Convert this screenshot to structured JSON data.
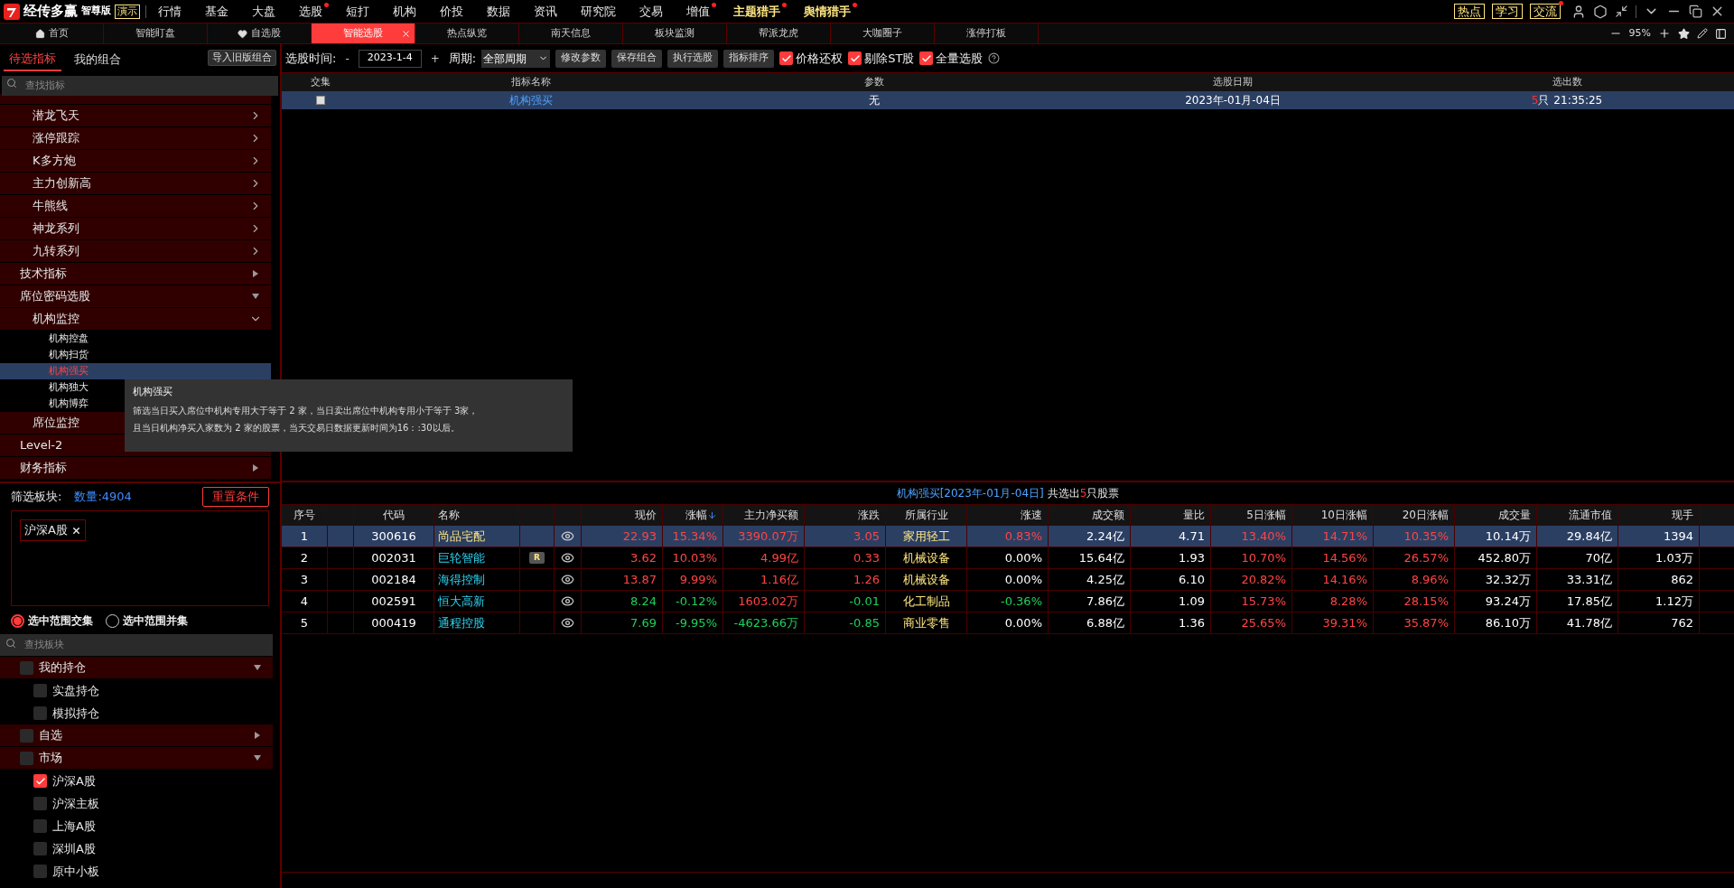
{
  "app": {
    "name": "经传多赢",
    "edition": "智尊版",
    "mode_badge": "演示"
  },
  "menu": [
    {
      "label": "行情",
      "kind": "normal",
      "dot": false
    },
    {
      "label": "基金",
      "kind": "normal",
      "dot": false
    },
    {
      "label": "大盘",
      "kind": "normal",
      "dot": false
    },
    {
      "label": "选股",
      "kind": "normal",
      "dot": true
    },
    {
      "label": "短打",
      "kind": "normal",
      "dot": false
    },
    {
      "label": "机构",
      "kind": "normal",
      "dot": false
    },
    {
      "label": "价投",
      "kind": "normal",
      "dot": false
    },
    {
      "label": "数据",
      "kind": "normal",
      "dot": false
    },
    {
      "label": "资讯",
      "kind": "normal",
      "dot": false
    },
    {
      "label": "研究院",
      "kind": "normal",
      "dot": false
    },
    {
      "label": "交易",
      "kind": "normal",
      "dot": false
    },
    {
      "label": "增值",
      "kind": "normal",
      "dot": true
    },
    {
      "label": "主题猎手",
      "kind": "feature",
      "dot": true
    },
    {
      "label": "舆情猎手",
      "kind": "feature",
      "dot": true
    }
  ],
  "quick_buttons": [
    {
      "label": "热点",
      "dot": false
    },
    {
      "label": "学习",
      "dot": false
    },
    {
      "label": "交流",
      "dot": true
    }
  ],
  "tabs": [
    {
      "label": "首页",
      "kind": "home",
      "selected": false
    },
    {
      "label": "智能盯盘",
      "kind": "plain",
      "selected": false
    },
    {
      "label": "自选股",
      "kind": "favorite",
      "selected": false
    },
    {
      "label": "智能选股",
      "kind": "plain",
      "selected": true
    },
    {
      "label": "热点纵览",
      "kind": "plain",
      "selected": false
    },
    {
      "label": "南天信息",
      "kind": "plain",
      "selected": false
    },
    {
      "label": "板块监测",
      "kind": "plain",
      "selected": false
    },
    {
      "label": "帮派龙虎",
      "kind": "plain",
      "selected": false
    },
    {
      "label": "大咖圈子",
      "kind": "plain",
      "selected": false
    },
    {
      "label": "涨停打板",
      "kind": "plain",
      "selected": false
    }
  ],
  "zoom": "95%",
  "left_tabs": [
    {
      "label": "待选指标",
      "selected": true
    },
    {
      "label": "我的组合",
      "selected": false
    }
  ],
  "import_button": "导入旧版组合",
  "indicator_search": {
    "placeholder": "查找指标"
  },
  "indicator_tree": [
    {
      "children": [
        {
          "label": "潜龙飞天",
          "expanded": false
        },
        {
          "label": "涨停跟踪",
          "expanded": false
        },
        {
          "label": "K多方炮",
          "expanded": false
        },
        {
          "label": "主力创新高",
          "expanded": false
        },
        {
          "label": "牛熊线",
          "expanded": false
        },
        {
          "label": "神龙系列",
          "expanded": false
        },
        {
          "label": "九转系列",
          "expanded": false
        }
      ]
    },
    {
      "label": "技术指标",
      "expanded": false
    },
    {
      "label": "席位密码选股",
      "expanded": true,
      "children": [
        {
          "label": "机构监控",
          "expanded": true,
          "children": [
            {
              "label": "机构控盘",
              "selected": false
            },
            {
              "label": "机构扫货",
              "selected": false
            },
            {
              "label": "机构强买",
              "selected": true
            },
            {
              "label": "机构独大",
              "selected": false
            },
            {
              "label": "机构博弈",
              "selected": false
            }
          ]
        },
        {
          "label": "席位监控"
        }
      ]
    },
    {
      "label": "Level-2"
    },
    {
      "label": "财务指标",
      "expanded": false
    }
  ],
  "tooltip": {
    "title": "机构强买",
    "lines": [
      "筛选当日买入席位中机构专用大于等于 2 家，当日卖出席位中机构专用小于等于 3家，",
      "且当日机构净买入家数为 2 家的股票，当天交易日数据更新时间为16：:30以后。"
    ]
  },
  "board_filter": {
    "label": "筛选板块:",
    "count": "数量:4904",
    "reset_button": "重置条件",
    "chips": [
      "沪深A股"
    ],
    "modes": [
      {
        "label": "选中范围交集",
        "selected": true
      },
      {
        "label": "选中范围并集",
        "selected": false
      }
    ],
    "search": {
      "placeholder": "查找板块"
    },
    "tree": [
      {
        "label": "我的持仓",
        "checked": false,
        "expanded": true,
        "children": [
          {
            "label": "实盘持仓",
            "checked": false
          },
          {
            "label": "模拟持仓",
            "checked": false
          }
        ]
      },
      {
        "label": "自选",
        "checked": false,
        "expanded": false
      },
      {
        "label": "市场",
        "checked": false,
        "expanded": true,
        "children": [
          {
            "label": "沪深A股",
            "checked": true
          },
          {
            "label": "沪深主板",
            "checked": false
          },
          {
            "label": "上海A股",
            "checked": false
          },
          {
            "label": "深圳A股",
            "checked": false
          },
          {
            "label": "原中小板",
            "checked": false
          }
        ]
      }
    ]
  },
  "toolbar": {
    "date_label": "选股时间:",
    "date_decrement": "-",
    "date": "2023-1-4",
    "date_increment": "+",
    "period_label": "周期:",
    "period": "全部周期",
    "buttons": [
      "修改参数",
      "保存组合",
      "执行选股",
      "指标排序"
    ],
    "options": [
      {
        "label": "价格还权",
        "checked": true
      },
      {
        "label": "剔除ST股",
        "checked": true
      },
      {
        "label": "全量选股",
        "checked": true
      }
    ]
  },
  "strategy_table": {
    "columns": [
      "交集",
      "指标名称",
      "参数",
      "选股日期",
      "选出数"
    ],
    "rows": [
      {
        "checked": false,
        "selected": true,
        "name": "机构强买",
        "params": "无",
        "date": "2023年-01月-04日",
        "count": "5",
        "count_unit": "只",
        "time": "21:35:25"
      }
    ]
  },
  "result": {
    "title": "机构强买[2023年-01月-04日]",
    "summary_prefix": "共选出",
    "count": "5",
    "summary_suffix": "只股票",
    "columns": [
      {
        "label": "序号"
      },
      {
        "label": "代码"
      },
      {
        "label": "名称"
      },
      {
        "label": "现价"
      },
      {
        "label": "涨幅",
        "sorted_descending": true
      },
      {
        "label": "主力净买额"
      },
      {
        "label": "涨跌"
      },
      {
        "label": "所属行业"
      },
      {
        "label": "涨速"
      },
      {
        "label": "成交额"
      },
      {
        "label": "量比"
      },
      {
        "label": "5日涨幅"
      },
      {
        "label": "10日涨幅"
      },
      {
        "label": "20日涨幅"
      },
      {
        "label": "成交量"
      },
      {
        "label": "流通市值"
      },
      {
        "label": "现手"
      }
    ],
    "rows": [
      {
        "selected": true,
        "index": "1",
        "code": "300616",
        "name": "尚品宅配",
        "price": "22.93",
        "change_pct": "15.34%",
        "net_buy": "3390.07万",
        "change": "3.05",
        "industry": "家用轻工",
        "speed": "0.83%",
        "amount": "2.24亿",
        "vol_ratio": "4.71",
        "chg5": "13.40%",
        "chg10": "14.71%",
        "chg20": "10.35%",
        "volume": "10.14万",
        "float_cap": "29.84亿",
        "last_vol": "1394"
      },
      {
        "selected": false,
        "index": "2",
        "code": "002031",
        "name": "巨轮智能",
        "badge": "R",
        "price": "3.62",
        "change_pct": "10.03%",
        "net_buy": "4.99亿",
        "change": "0.33",
        "industry": "机械设备",
        "speed": "0.00%",
        "amount": "15.64亿",
        "vol_ratio": "1.93",
        "chg5": "10.70%",
        "chg10": "14.56%",
        "chg20": "26.57%",
        "volume": "452.80万",
        "float_cap": "70亿",
        "last_vol": "1.03万"
      },
      {
        "selected": false,
        "index": "3",
        "code": "002184",
        "name": "海得控制",
        "price": "13.87",
        "change_pct": "9.99%",
        "net_buy": "1.16亿",
        "change": "1.26",
        "industry": "机械设备",
        "speed": "0.00%",
        "amount": "4.25亿",
        "vol_ratio": "6.10",
        "chg5": "20.82%",
        "chg10": "14.16%",
        "chg20": "8.96%",
        "volume": "32.32万",
        "float_cap": "33.31亿",
        "last_vol": "862"
      },
      {
        "selected": false,
        "index": "4",
        "code": "002591",
        "name": "恒大高新",
        "price": "8.24",
        "change_pct": "-0.12%",
        "net_buy": "1603.02万",
        "change": "-0.01",
        "industry": "化工制品",
        "speed": "-0.36%",
        "amount": "7.86亿",
        "vol_ratio": "1.09",
        "chg5": "15.73%",
        "chg10": "8.28%",
        "chg20": "28.15%",
        "volume": "93.24万",
        "float_cap": "17.85亿",
        "last_vol": "1.12万"
      },
      {
        "selected": false,
        "index": "5",
        "code": "000419",
        "name": "通程控股",
        "price": "7.69",
        "change_pct": "-9.95%",
        "net_buy": "-4623.66万",
        "change": "-0.85",
        "industry": "商业零售",
        "speed": "0.00%",
        "amount": "6.88亿",
        "vol_ratio": "1.36",
        "chg5": "25.65%",
        "chg10": "39.31%",
        "chg20": "35.87%",
        "volume": "86.10万",
        "float_cap": "41.78亿",
        "last_vol": "762"
      }
    ]
  }
}
